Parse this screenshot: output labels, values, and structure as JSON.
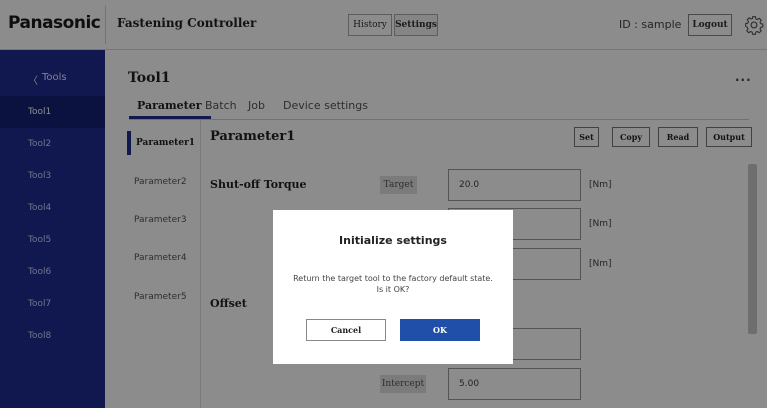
{
  "header": {
    "logo": "Panasonic",
    "app_title": "Fastening Controller",
    "history_label": "History",
    "settings_label": "Settings",
    "user_id": "ID : sample",
    "logout_label": "Logout",
    "settings_icon": "gear-icon"
  },
  "sidebar": {
    "back_label": "Tools",
    "items": [
      {
        "label": "Tool1",
        "active": true
      },
      {
        "label": "Tool2"
      },
      {
        "label": "Tool3"
      },
      {
        "label": "Tool4"
      },
      {
        "label": "Tool5"
      },
      {
        "label": "Tool6"
      },
      {
        "label": "Tool7"
      },
      {
        "label": "Tool8"
      }
    ]
  },
  "main": {
    "tool_title": "Tool1",
    "more_label": "...",
    "tabs": [
      {
        "label": "Parameter",
        "active": true
      },
      {
        "label": "Batch"
      },
      {
        "label": "Job"
      },
      {
        "label": "Device settings"
      }
    ],
    "parameters": [
      {
        "label": "Parameter1",
        "active": true
      },
      {
        "label": "Parameter2"
      },
      {
        "label": "Parameter3"
      },
      {
        "label": "Parameter4"
      },
      {
        "label": "Parameter5"
      }
    ],
    "param_title": "Parameter1",
    "actions": {
      "set": "Set",
      "copy": "Copy",
      "read": "Read",
      "output": "Output"
    },
    "shutoff": {
      "label": "Shut-off Torque",
      "target_tag": "Target",
      "target_value": "20.0",
      "unit1": "[Nm]",
      "unit2": "[Nm]",
      "unit3": "[Nm]"
    },
    "offset": {
      "label": "Offset",
      "intercept_tag": "Intercept",
      "intercept_value": "5.00"
    }
  },
  "dialog": {
    "title": "Initialize settings",
    "message_line1": "Return the target tool to the factory default state.",
    "message_line2": "Is it OK?",
    "cancel_label": "Cancel",
    "ok_label": "OK"
  },
  "colors": {
    "sidebar_bg": "#1f2d92",
    "primary_button": "#1f4fa8",
    "overlay": "rgba(0,0,0,0.45)"
  }
}
